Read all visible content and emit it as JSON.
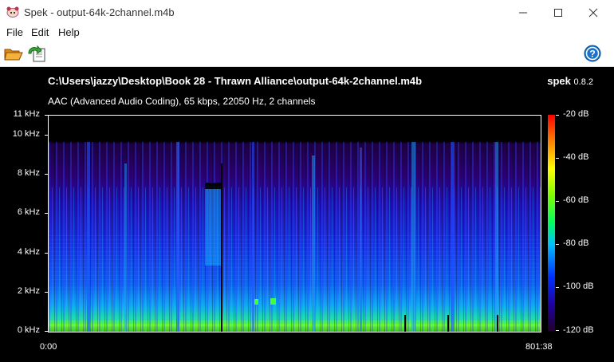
{
  "window": {
    "title": "Spek - output-64k-2channel.m4b",
    "minimize_icon": "minimize-icon",
    "maximize_icon": "maximize-icon",
    "close_icon": "close-icon"
  },
  "menu": {
    "items": [
      "File",
      "Edit",
      "Help"
    ]
  },
  "toolbar": {
    "open_icon": "folder-open-icon",
    "save_icon": "save-image-icon",
    "help_icon": "help-icon"
  },
  "spectrogram": {
    "file_path": "C:\\Users\\jazzy\\Desktop\\Book 28 - Thrawn Alliance\\output-64k-2channel.m4b",
    "brand_name": "spek",
    "brand_version": "0.8.2",
    "file_info": "AAC (Advanced Audio Coding), 65 kbps, 22050 Hz, 2 channels",
    "freq_ticks": [
      "11 kHz",
      "10 kHz",
      "8 kHz",
      "6 kHz",
      "4 kHz",
      "2 kHz",
      "0 kHz"
    ],
    "time_start": "0:00",
    "time_end": "801:38",
    "db_ticks": [
      "-20 dB",
      "-40 dB",
      "-60 dB",
      "-80 dB",
      "-100 dB",
      "-120 dB"
    ]
  },
  "colors": {
    "background": "#000000",
    "chrome": "#ffffff",
    "help_blue": "#1a73c8"
  }
}
